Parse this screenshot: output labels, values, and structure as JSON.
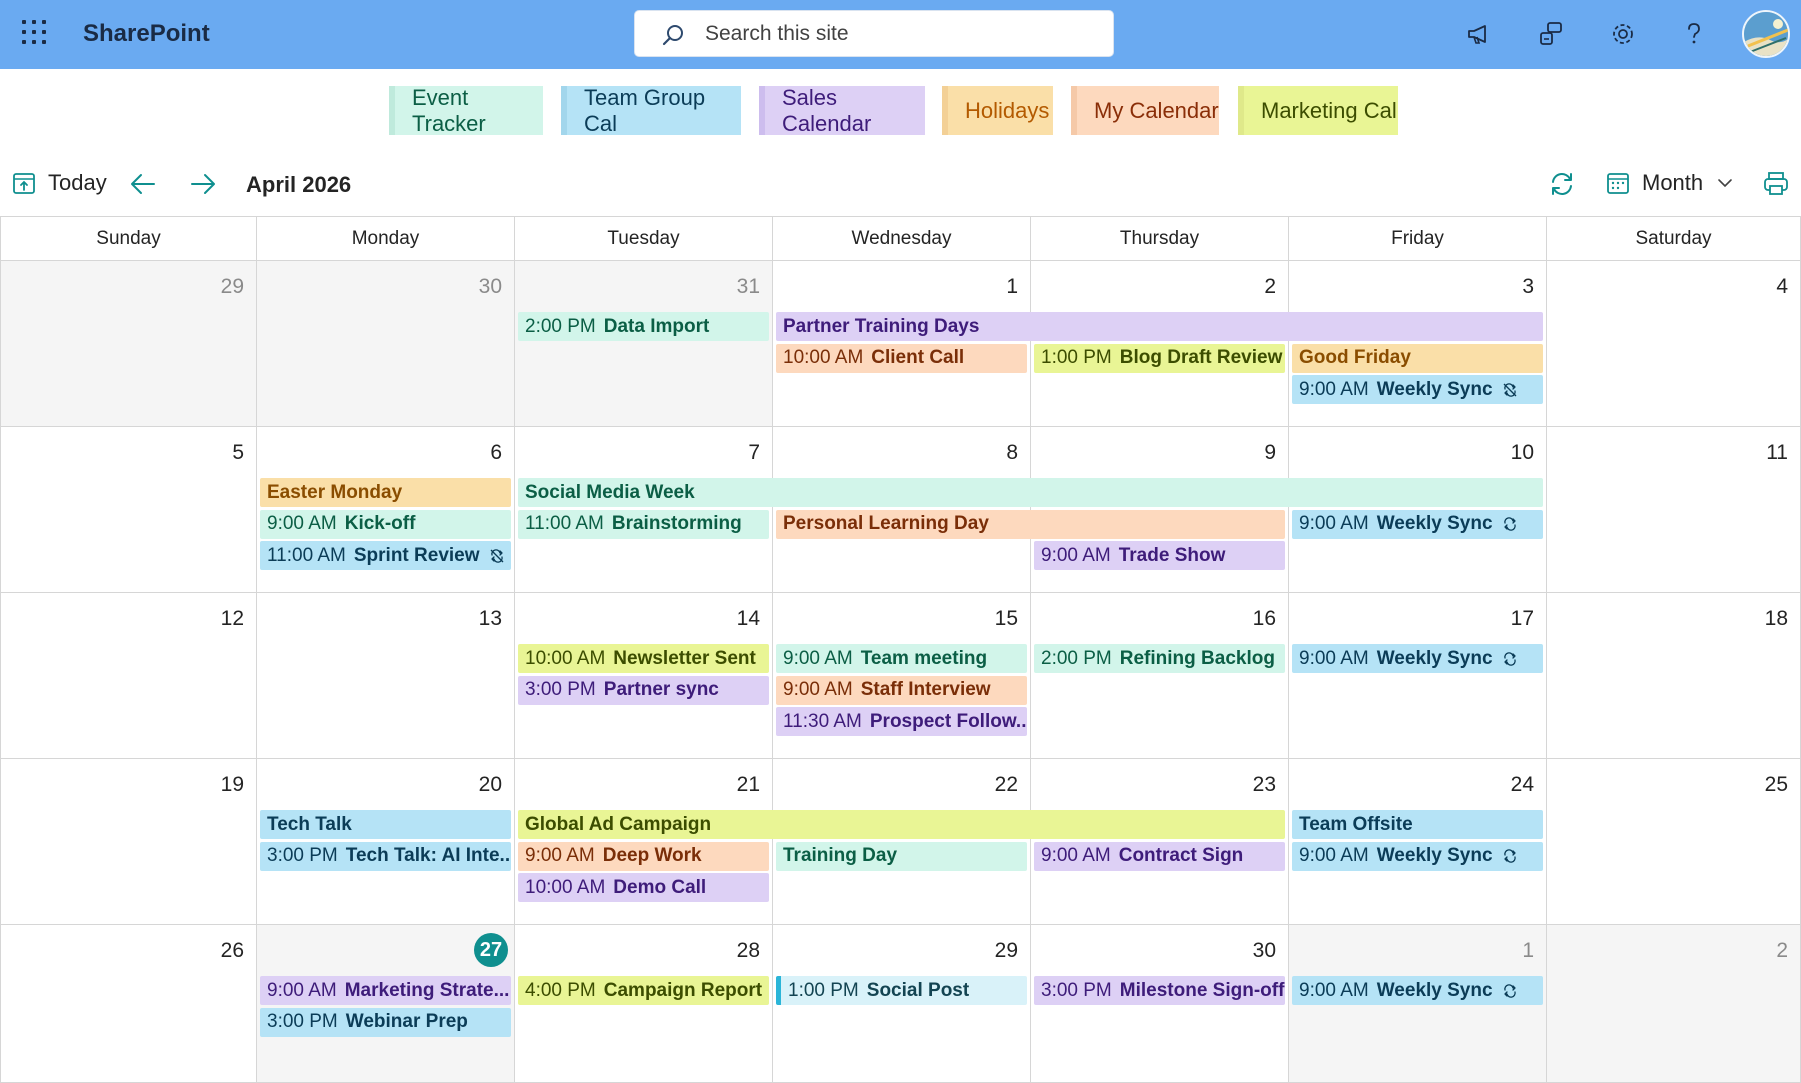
{
  "suite": {
    "app_name": "SharePoint",
    "search_placeholder": "Search this site"
  },
  "calendars": [
    {
      "label": "Event Tracker",
      "bg": "#d2f5ea",
      "fg": "#0b5e45",
      "bar": "#bfeadc"
    },
    {
      "label": "Team Group Cal",
      "bg": "#b5e3f6",
      "fg": "#0b3c57",
      "bar": "#a2d6ec"
    },
    {
      "label": "Sales Calendar",
      "bg": "#ddd0f5",
      "fg": "#3e1c7a",
      "bar": "#cdbdee"
    },
    {
      "label": "Holidays",
      "bg": "#fadfa8",
      "fg": "#b35a00",
      "bar": "#f3d096"
    },
    {
      "label": "My Calendar",
      "bg": "#fdd9be",
      "fg": "#8a2e08",
      "bar": "#f5c9a8"
    },
    {
      "label": "Marketing Cal",
      "bg": "#e9f595",
      "fg": "#3c4d00",
      "bar": "#dfe98a"
    }
  ],
  "toolbar": {
    "today_label": "Today",
    "month_label": "April 2026",
    "view_label": "Month"
  },
  "weekdays": [
    "Sunday",
    "Monday",
    "Tuesday",
    "Wednesday",
    "Thursday",
    "Friday",
    "Saturday"
  ],
  "weeks": [
    {
      "days": [
        {
          "n": "29",
          "muted": true
        },
        {
          "n": "30",
          "muted": true
        },
        {
          "n": "31",
          "muted": true
        },
        {
          "n": "1"
        },
        {
          "n": "2"
        },
        {
          "n": "3"
        },
        {
          "n": "4"
        }
      ]
    },
    {
      "days": [
        {
          "n": "5"
        },
        {
          "n": "6"
        },
        {
          "n": "7"
        },
        {
          "n": "8"
        },
        {
          "n": "9"
        },
        {
          "n": "10"
        },
        {
          "n": "11"
        }
      ]
    },
    {
      "days": [
        {
          "n": "12"
        },
        {
          "n": "13"
        },
        {
          "n": "14"
        },
        {
          "n": "15"
        },
        {
          "n": "16"
        },
        {
          "n": "17"
        },
        {
          "n": "18"
        }
      ]
    },
    {
      "days": [
        {
          "n": "19"
        },
        {
          "n": "20"
        },
        {
          "n": "21"
        },
        {
          "n": "22"
        },
        {
          "n": "23"
        },
        {
          "n": "24"
        },
        {
          "n": "25"
        }
      ]
    },
    {
      "days": [
        {
          "n": "26"
        },
        {
          "n": "27",
          "today": true
        },
        {
          "n": "28"
        },
        {
          "n": "29"
        },
        {
          "n": "30"
        },
        {
          "n": "1",
          "muted": true
        },
        {
          "n": "2",
          "muted": true
        }
      ]
    }
  ],
  "events": [
    {
      "week": 0,
      "day": 2,
      "span": 1,
      "row": 0,
      "time": "2:00 PM",
      "title": "Data Import",
      "color": "mint"
    },
    {
      "week": 0,
      "day": 3,
      "span": 3,
      "row": 0,
      "time": "",
      "title": "Partner Training Days",
      "color": "purple"
    },
    {
      "week": 0,
      "day": 3,
      "span": 1,
      "row": 1,
      "time": "10:00 AM",
      "title": "Client Call",
      "color": "orange"
    },
    {
      "week": 0,
      "day": 4,
      "span": 1,
      "row": 1,
      "time": "1:00 PM",
      "title": "Blog Draft Review",
      "color": "lime"
    },
    {
      "week": 0,
      "day": 5,
      "span": 1,
      "row": 1,
      "time": "",
      "title": "Good Friday",
      "color": "yellow"
    },
    {
      "week": 0,
      "day": 5,
      "span": 1,
      "row": 2,
      "time": "9:00 AM",
      "title": "Weekly Sync",
      "color": "blue",
      "icon": "no-repeat"
    },
    {
      "week": 1,
      "day": 1,
      "span": 1,
      "row": 0,
      "time": "",
      "title": "Easter Monday",
      "color": "yellow"
    },
    {
      "week": 1,
      "day": 2,
      "span": 4,
      "row": 0,
      "time": "",
      "title": "Social Media Week",
      "color": "mint"
    },
    {
      "week": 1,
      "day": 1,
      "span": 1,
      "row": 1,
      "time": "9:00 AM",
      "title": "Kick-off",
      "color": "mint"
    },
    {
      "week": 1,
      "day": 2,
      "span": 1,
      "row": 1,
      "time": "11:00 AM",
      "title": "Brainstorming",
      "color": "mint"
    },
    {
      "week": 1,
      "day": 3,
      "span": 2,
      "row": 1,
      "time": "",
      "title": "Personal Learning Day",
      "color": "orange"
    },
    {
      "week": 1,
      "day": 5,
      "span": 1,
      "row": 1,
      "time": "9:00 AM",
      "title": "Weekly Sync",
      "color": "blue",
      "icon": "repeat"
    },
    {
      "week": 1,
      "day": 1,
      "span": 1,
      "row": 2,
      "time": "11:00 AM",
      "title": "Sprint Review",
      "color": "blue",
      "icon": "no-repeat"
    },
    {
      "week": 1,
      "day": 4,
      "span": 1,
      "row": 2,
      "time": "9:00 AM",
      "title": "Trade Show",
      "color": "purple"
    },
    {
      "week": 2,
      "day": 2,
      "span": 1,
      "row": 0,
      "time": "10:00 AM",
      "title": "Newsletter Sent",
      "color": "lime"
    },
    {
      "week": 2,
      "day": 3,
      "span": 1,
      "row": 0,
      "time": "9:00 AM",
      "title": "Team meeting",
      "color": "mint"
    },
    {
      "week": 2,
      "day": 4,
      "span": 1,
      "row": 0,
      "time": "2:00 PM",
      "title": "Refining Backlog",
      "color": "mint"
    },
    {
      "week": 2,
      "day": 5,
      "span": 1,
      "row": 0,
      "time": "9:00 AM",
      "title": "Weekly Sync",
      "color": "blue",
      "icon": "repeat"
    },
    {
      "week": 2,
      "day": 2,
      "span": 1,
      "row": 1,
      "time": "3:00 PM",
      "title": "Partner sync",
      "color": "purple"
    },
    {
      "week": 2,
      "day": 3,
      "span": 1,
      "row": 1,
      "time": "9:00 AM",
      "title": "Staff Interview",
      "color": "orange"
    },
    {
      "week": 2,
      "day": 3,
      "span": 1,
      "row": 2,
      "time": "11:30 AM",
      "title": "Prospect Follow...",
      "color": "purple"
    },
    {
      "week": 3,
      "day": 1,
      "span": 1,
      "row": 0,
      "time": "",
      "title": "Tech Talk",
      "color": "blue"
    },
    {
      "week": 3,
      "day": 2,
      "span": 3,
      "row": 0,
      "time": "",
      "title": "Global Ad Campaign",
      "color": "lime"
    },
    {
      "week": 3,
      "day": 5,
      "span": 1,
      "row": 0,
      "time": "",
      "title": "Team Offsite",
      "color": "blue"
    },
    {
      "week": 3,
      "day": 1,
      "span": 1,
      "row": 1,
      "time": "3:00 PM",
      "title": "Tech Talk: AI Inte...",
      "color": "blue"
    },
    {
      "week": 3,
      "day": 2,
      "span": 1,
      "row": 1,
      "time": "9:00 AM",
      "title": "Deep Work",
      "color": "orange"
    },
    {
      "week": 3,
      "day": 3,
      "span": 1,
      "row": 1,
      "time": "",
      "title": "Training Day",
      "color": "mint"
    },
    {
      "week": 3,
      "day": 4,
      "span": 1,
      "row": 1,
      "time": "9:00 AM",
      "title": "Contract Sign",
      "color": "purple"
    },
    {
      "week": 3,
      "day": 5,
      "span": 1,
      "row": 1,
      "time": "9:00 AM",
      "title": "Weekly Sync",
      "color": "blue",
      "icon": "repeat"
    },
    {
      "week": 3,
      "day": 2,
      "span": 1,
      "row": 2,
      "time": "10:00 AM",
      "title": "Demo Call",
      "color": "purple"
    },
    {
      "week": 4,
      "day": 1,
      "span": 1,
      "row": 0,
      "time": "9:00 AM",
      "title": "Marketing Strate...",
      "color": "purple"
    },
    {
      "week": 4,
      "day": 2,
      "span": 1,
      "row": 0,
      "time": "4:00 PM",
      "title": "Campaign Report",
      "color": "lime"
    },
    {
      "week": 4,
      "day": 3,
      "span": 1,
      "row": 0,
      "time": "1:00 PM",
      "title": "Social Post",
      "color": "cyan"
    },
    {
      "week": 4,
      "day": 4,
      "span": 1,
      "row": 0,
      "time": "3:00 PM",
      "title": "Milestone Sign-off",
      "color": "purple"
    },
    {
      "week": 4,
      "day": 5,
      "span": 1,
      "row": 0,
      "time": "9:00 AM",
      "title": "Weekly Sync",
      "color": "blue",
      "icon": "repeat"
    },
    {
      "week": 4,
      "day": 1,
      "span": 1,
      "row": 1,
      "time": "3:00 PM",
      "title": "Webinar Prep",
      "color": "blue"
    }
  ]
}
